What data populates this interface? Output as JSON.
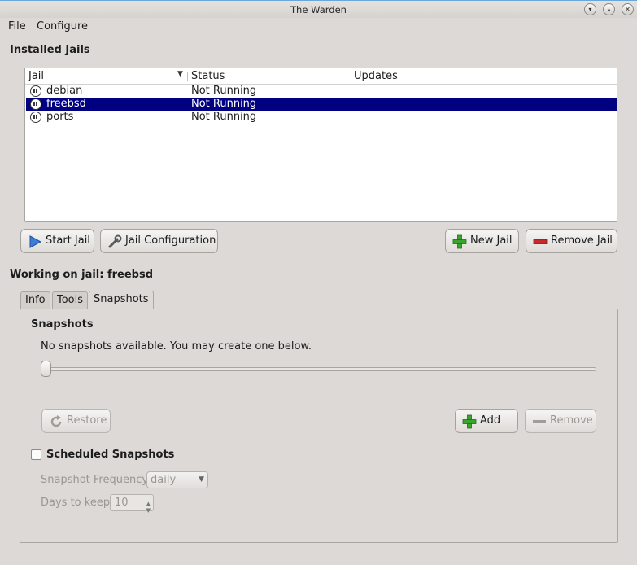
{
  "window": {
    "title": "The Warden"
  },
  "menu": {
    "file": "File",
    "configure": "Configure"
  },
  "installed_jails": {
    "title": "Installed Jails",
    "columns": [
      "Jail",
      "Status",
      "Updates"
    ],
    "rows": [
      {
        "name": "debian",
        "status": "Not Running",
        "updates": "",
        "selected": false
      },
      {
        "name": "freebsd",
        "status": "Not Running",
        "updates": "",
        "selected": true
      },
      {
        "name": "ports",
        "status": "Not Running",
        "updates": "",
        "selected": false
      }
    ]
  },
  "actions": {
    "start_jail": "Start Jail",
    "jail_configuration": "Jail Configuration",
    "new_jail": "New Jail",
    "remove_jail": "Remove Jail"
  },
  "working_on": "Working on jail: freebsd",
  "tabs": [
    {
      "label": "Info",
      "active": false
    },
    {
      "label": "Tools",
      "active": false
    },
    {
      "label": "Snapshots",
      "active": true
    }
  ],
  "snapshots": {
    "title": "Snapshots",
    "message": "No snapshots available. You may create one below.",
    "restore": "Restore",
    "add": "Add",
    "remove": "Remove",
    "scheduled_label": "Scheduled Snapshots",
    "scheduled_checked": false,
    "frequency_label": "Snapshot Frequency",
    "frequency_value": "daily",
    "days_label": "Days to keep",
    "days_value": "10"
  },
  "colors": {
    "selection": "#000080",
    "background": "#dcd9d6",
    "add_green": "#3aa52d",
    "remove_red": "#c62a2a"
  }
}
